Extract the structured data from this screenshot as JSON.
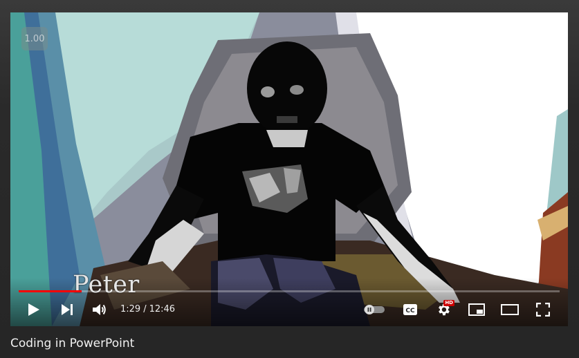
{
  "player": {
    "speed_badge": "1.00",
    "caption": "Peter",
    "progress_fraction": 0.116,
    "time": {
      "current": "1:29",
      "separator": "/",
      "duration": "12:46"
    },
    "controls": {
      "play_icon": "play-icon",
      "next_icon": "next-icon",
      "volume_icon": "volume-icon",
      "autoplay_icon": "autoplay-toggle-icon",
      "subtitles_icon": "cc-icon",
      "settings_icon": "gear-icon",
      "settings_badge": "HD",
      "miniplayer_icon": "miniplayer-icon",
      "theater_icon": "theater-icon",
      "fullscreen_icon": "fullscreen-icon"
    },
    "colors": {
      "progress": "#ff0000",
      "hd_badge": "#cc0000"
    }
  },
  "video": {
    "title": "Coding in PowerPoint"
  }
}
